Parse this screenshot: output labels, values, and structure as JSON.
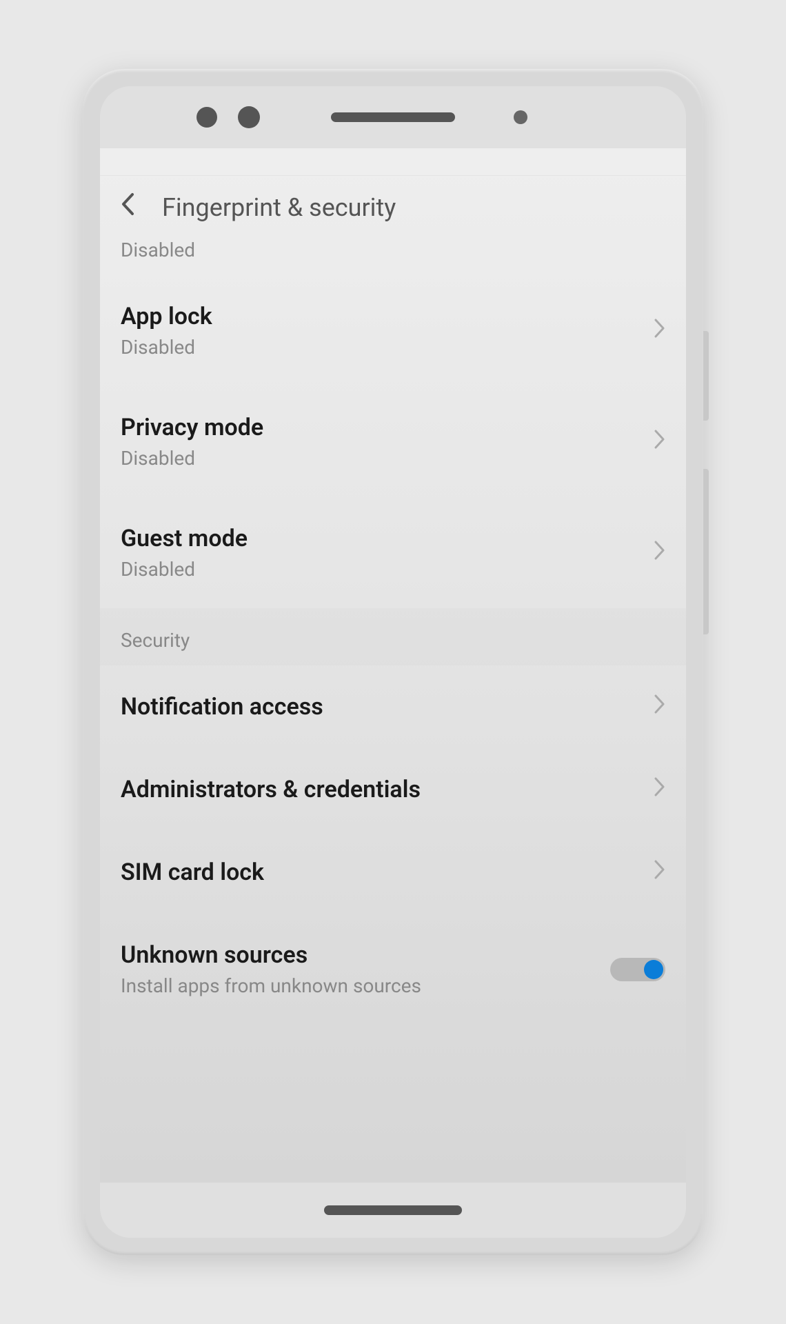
{
  "header": {
    "title": "Fingerprint & security"
  },
  "partial_item": {
    "subtitle": "Disabled"
  },
  "items": [
    {
      "title": "App lock",
      "subtitle": "Disabled"
    },
    {
      "title": "Privacy mode",
      "subtitle": "Disabled"
    },
    {
      "title": "Guest mode",
      "subtitle": "Disabled"
    }
  ],
  "section": {
    "title": "Security"
  },
  "security_items": [
    {
      "title": "Notification access"
    },
    {
      "title": "Administrators & credentials"
    },
    {
      "title": "SIM card lock"
    }
  ],
  "toggle_item": {
    "title": "Unknown sources",
    "subtitle": "Install apps from unknown sources",
    "enabled": true
  }
}
